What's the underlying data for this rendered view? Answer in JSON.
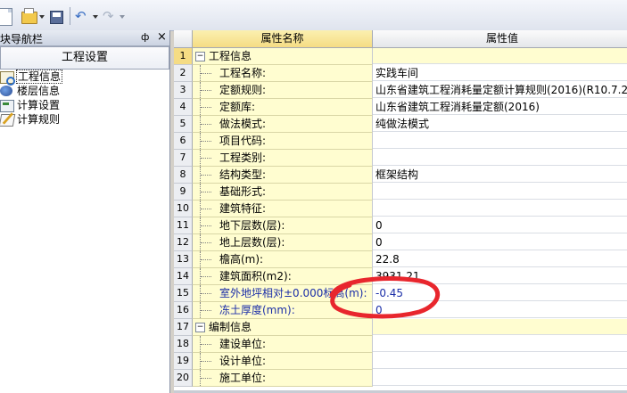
{
  "left_panel": {
    "title": "块导航栏",
    "pin": "ф",
    "close": "×",
    "tab": "工程设置",
    "items": [
      {
        "label": "工程信息",
        "icon": "project-info-icon",
        "selected": true
      },
      {
        "label": "楼层信息",
        "icon": "floor-info-icon",
        "selected": false
      },
      {
        "label": "计算设置",
        "icon": "calc-settings-icon",
        "selected": false
      },
      {
        "label": "计算规则",
        "icon": "calc-rules-icon",
        "selected": false
      }
    ]
  },
  "grid": {
    "columns": {
      "name": "属性名称",
      "value": "属性值"
    },
    "rows": [
      {
        "num": "1",
        "name": "工程信息",
        "value": "",
        "group": true,
        "toggle": "−"
      },
      {
        "num": "2",
        "name": "工程名称:",
        "value": "实践车间"
      },
      {
        "num": "3",
        "name": "定额规则:",
        "value": "山东省建筑工程消耗量定额计算规则(2016)(R10.7.2."
      },
      {
        "num": "4",
        "name": "定额库:",
        "value": "山东省建筑工程消耗量定额(2016)"
      },
      {
        "num": "5",
        "name": "做法模式:",
        "value": "纯做法模式"
      },
      {
        "num": "6",
        "name": "项目代码:",
        "value": ""
      },
      {
        "num": "7",
        "name": "工程类别:",
        "value": ""
      },
      {
        "num": "8",
        "name": "结构类型:",
        "value": "框架结构"
      },
      {
        "num": "9",
        "name": "基础形式:",
        "value": ""
      },
      {
        "num": "10",
        "name": "建筑特征:",
        "value": ""
      },
      {
        "num": "11",
        "name": "地下层数(层):",
        "value": "0"
      },
      {
        "num": "12",
        "name": "地上层数(层):",
        "value": "0"
      },
      {
        "num": "13",
        "name": "檐高(m):",
        "value": "22.8"
      },
      {
        "num": "14",
        "name": "建筑面积(m2):",
        "value": "3931.21"
      },
      {
        "num": "15",
        "name": "室外地坪相对±0.000标高(m):",
        "value": "-0.45",
        "blue": true
      },
      {
        "num": "16",
        "name": "冻土厚度(mm):",
        "value": "0",
        "blue": true
      },
      {
        "num": "17",
        "name": "编制信息",
        "value": "",
        "group": true,
        "toggle": "−"
      },
      {
        "num": "18",
        "name": "建设单位:",
        "value": ""
      },
      {
        "num": "19",
        "name": "设计单位:",
        "value": ""
      },
      {
        "num": "20",
        "name": "施工单位:",
        "value": ""
      }
    ]
  },
  "annotation_color": "#e8262d"
}
